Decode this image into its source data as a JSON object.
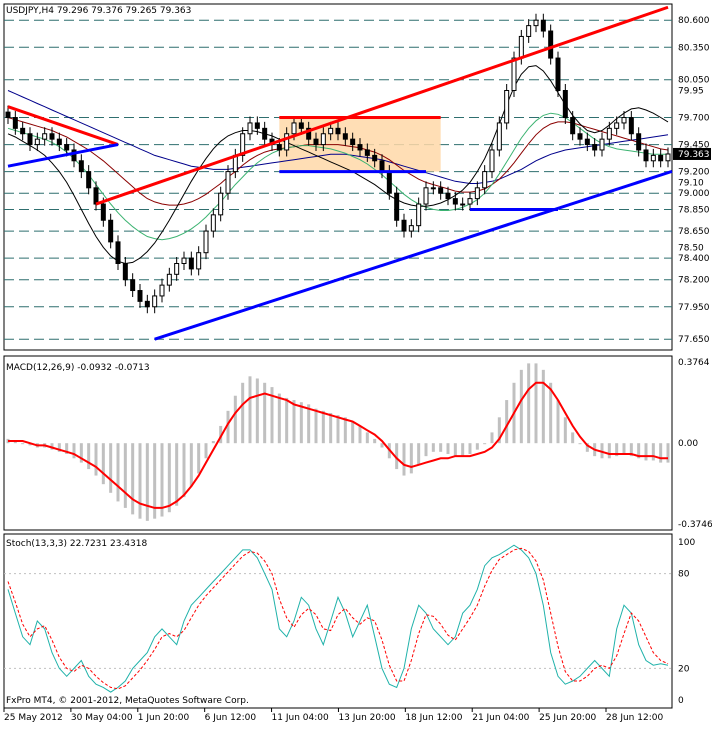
{
  "chart_data": [
    {
      "type": "candlestick",
      "header": "USDJPY,H4  79.296 79.376 79.265 79.363",
      "ylim": [
        77.55,
        80.75
      ],
      "price_levels": [
        80.6,
        80.35,
        80.05,
        79.7,
        79.45,
        79.2,
        79.0,
        78.85,
        78.65,
        78.4,
        78.2,
        77.95,
        77.65
      ],
      "price_labels": [
        "80.600",
        "80.350",
        "80.050",
        "79.700",
        "79.450",
        "79.200",
        "79.000",
        "78.850",
        "78.650",
        "78.400",
        "78.200",
        "77.950",
        "77.650"
      ],
      "extra_tick_labels": [
        {
          "value": 79.95,
          "label": "79.95"
        },
        {
          "value": 79.1,
          "label": "79.10"
        },
        {
          "value": 78.5,
          "label": "78.50"
        }
      ],
      "current_price": 79.363,
      "current_price_label": "79.363",
      "close_series": [
        79.7,
        79.6,
        79.55,
        79.45,
        79.5,
        79.55,
        79.5,
        79.45,
        79.4,
        79.3,
        79.2,
        79.05,
        78.9,
        78.75,
        78.55,
        78.35,
        78.2,
        78.1,
        78.0,
        77.95,
        78.05,
        78.15,
        78.25,
        78.35,
        78.4,
        78.3,
        78.45,
        78.65,
        78.8,
        79.0,
        79.2,
        79.35,
        79.55,
        79.65,
        79.6,
        79.5,
        79.45,
        79.4,
        79.55,
        79.65,
        79.6,
        79.5,
        79.45,
        79.55,
        79.6,
        79.55,
        79.5,
        79.45,
        79.4,
        79.35,
        79.3,
        79.2,
        79.0,
        78.75,
        78.65,
        78.7,
        78.9,
        79.05,
        79.05,
        79.0,
        78.95,
        78.9,
        78.9,
        78.95,
        79.05,
        79.2,
        79.4,
        79.65,
        79.95,
        80.25,
        80.45,
        80.55,
        80.6,
        80.5,
        80.25,
        79.95,
        79.7,
        79.55,
        79.5,
        79.45,
        79.4,
        79.5,
        79.6,
        79.65,
        79.7,
        79.55,
        79.4,
        79.3,
        79.35,
        79.3,
        79.363
      ],
      "trendlines": [
        {
          "color": "#ff0000",
          "from": [
            0,
            79.8
          ],
          "to": [
            15,
            79.45
          ]
        },
        {
          "color": "#0000ff",
          "from": [
            0,
            79.25
          ],
          "to": [
            15,
            79.45
          ]
        },
        {
          "color": "#ff0000",
          "from": [
            12,
            78.9
          ],
          "to": [
            90,
            80.72
          ]
        },
        {
          "color": "#0000ff",
          "from": [
            20,
            77.65
          ],
          "to": [
            120,
            79.85
          ]
        },
        {
          "color": "#0000ff",
          "from": [
            37,
            79.2
          ],
          "to": [
            57,
            79.2
          ]
        },
        {
          "color": "#0000ff",
          "from": [
            63,
            78.85
          ],
          "to": [
            75,
            78.85
          ]
        }
      ],
      "rectangle": {
        "from": [
          37,
          79.2
        ],
        "to": [
          59,
          79.7
        ],
        "color": "#ffd8a8"
      },
      "rectangle_top": {
        "color": "#ff0000",
        "from": [
          37,
          79.7
        ],
        "to": [
          59,
          79.7
        ]
      },
      "moving_averages": [
        {
          "color": "#00008b",
          "values": [
            79.95,
            79.92,
            79.89,
            79.86,
            79.83,
            79.8,
            79.77,
            79.74,
            79.71,
            79.68,
            79.65,
            79.62,
            79.59,
            79.56,
            79.53,
            79.5,
            79.47,
            79.44,
            79.41,
            79.38,
            79.35,
            79.33,
            79.31,
            79.29,
            79.27,
            79.25,
            79.24,
            79.23,
            79.22,
            79.22,
            79.22,
            79.23,
            79.24,
            79.25,
            79.26,
            79.27,
            79.28,
            79.29,
            79.3,
            79.31,
            79.32,
            79.33,
            79.34,
            79.35,
            79.36,
            79.36,
            79.36,
            79.35,
            79.34,
            79.33,
            79.32,
            79.31,
            79.29,
            79.27,
            79.25,
            79.23,
            79.21,
            79.19,
            79.17,
            79.15,
            79.13,
            79.11,
            79.1,
            79.09,
            79.09,
            79.1,
            79.11,
            79.13,
            79.16,
            79.19,
            79.22,
            79.26,
            79.3,
            79.33,
            79.36,
            79.38,
            79.4,
            79.41,
            79.42,
            79.43,
            79.44,
            79.45,
            79.46,
            79.47,
            79.48,
            79.49,
            79.5,
            79.51,
            79.52,
            79.53,
            79.54
          ]
        },
        {
          "color": "#8b0000",
          "values": [
            79.7,
            79.68,
            79.66,
            79.64,
            79.62,
            79.6,
            79.58,
            79.55,
            79.52,
            79.48,
            79.44,
            79.4,
            79.35,
            79.3,
            79.24,
            79.18,
            79.12,
            79.06,
            79.0,
            78.95,
            78.92,
            78.9,
            78.89,
            78.89,
            78.9,
            78.92,
            78.95,
            78.99,
            79.04,
            79.09,
            79.15,
            79.2,
            79.26,
            79.31,
            79.35,
            79.38,
            79.4,
            79.41,
            79.42,
            79.43,
            79.44,
            79.45,
            79.45,
            79.45,
            79.45,
            79.45,
            79.44,
            79.43,
            79.42,
            79.4,
            79.38,
            79.35,
            79.31,
            79.26,
            79.21,
            79.17,
            79.13,
            79.1,
            79.08,
            79.06,
            79.04,
            79.02,
            79.01,
            79.01,
            79.02,
            79.04,
            79.08,
            79.13,
            79.2,
            79.28,
            79.37,
            79.46,
            79.54,
            79.6,
            79.64,
            79.66,
            79.66,
            79.65,
            79.63,
            79.61,
            79.59,
            79.57,
            79.55,
            79.53,
            79.51,
            79.49,
            79.47,
            79.45,
            79.43,
            79.41,
            79.4
          ]
        },
        {
          "color": "#3cb371",
          "values": [
            79.6,
            79.58,
            79.56,
            79.54,
            79.52,
            79.5,
            79.47,
            79.43,
            79.38,
            79.32,
            79.25,
            79.17,
            79.08,
            78.99,
            78.9,
            78.82,
            78.75,
            78.69,
            78.64,
            78.6,
            78.58,
            78.57,
            78.58,
            78.6,
            78.63,
            78.67,
            78.72,
            78.78,
            78.85,
            78.92,
            79.0,
            79.08,
            79.15,
            79.22,
            79.28,
            79.33,
            79.37,
            79.4,
            79.42,
            79.43,
            79.44,
            79.44,
            79.43,
            79.42,
            79.41,
            79.39,
            79.37,
            79.34,
            79.31,
            79.27,
            79.22,
            79.17,
            79.11,
            79.05,
            78.99,
            78.94,
            78.9,
            78.87,
            78.85,
            78.84,
            78.84,
            78.85,
            78.87,
            78.9,
            78.94,
            79.0,
            79.08,
            79.18,
            79.29,
            79.4,
            79.51,
            79.6,
            79.67,
            79.72,
            79.74,
            79.73,
            79.7,
            79.65,
            79.6,
            79.55,
            79.5,
            79.46,
            79.43,
            79.41,
            79.4,
            79.39,
            79.38,
            79.37,
            79.36,
            79.36,
            79.36
          ]
        },
        {
          "color": "#000000",
          "values": [
            79.55,
            79.52,
            79.48,
            79.44,
            79.4,
            79.35,
            79.28,
            79.2,
            79.1,
            78.98,
            78.85,
            78.72,
            78.6,
            78.5,
            78.42,
            78.37,
            78.35,
            78.36,
            78.4,
            78.46,
            78.54,
            78.64,
            78.75,
            78.87,
            78.99,
            79.11,
            79.22,
            79.32,
            79.41,
            79.48,
            79.53,
            79.56,
            79.58,
            79.58,
            79.57,
            79.55,
            79.53,
            79.5,
            79.47,
            79.44,
            79.41,
            79.38,
            79.35,
            79.32,
            79.29,
            79.26,
            79.23,
            79.2,
            79.16,
            79.12,
            79.08,
            79.03,
            78.98,
            78.94,
            78.91,
            78.89,
            78.88,
            78.88,
            78.89,
            78.91,
            78.94,
            78.98,
            79.03,
            79.1,
            79.2,
            79.32,
            79.47,
            79.64,
            79.82,
            79.98,
            80.1,
            80.17,
            80.18,
            80.13,
            80.04,
            79.93,
            79.82,
            79.72,
            79.64,
            79.58,
            79.56,
            79.58,
            79.63,
            79.69,
            79.74,
            79.78,
            79.79,
            79.77,
            79.74,
            79.7,
            79.66
          ]
        }
      ]
    },
    {
      "type": "histogram-line",
      "header": "MACD(12,26,9) -0.0932 -0.0713",
      "ylim": [
        -0.3746,
        0.3764
      ],
      "tick_labels": [
        {
          "value": 0.3764,
          "label": "0.3764"
        },
        {
          "value": 0.0,
          "label": "0.00"
        },
        {
          "value": -0.3746,
          "label": "-0.3746"
        }
      ],
      "histogram": [
        0.02,
        0.01,
        0.0,
        -0.01,
        -0.02,
        -0.02,
        -0.03,
        -0.04,
        -0.05,
        -0.07,
        -0.09,
        -0.12,
        -0.15,
        -0.19,
        -0.23,
        -0.27,
        -0.3,
        -0.33,
        -0.35,
        -0.36,
        -0.35,
        -0.34,
        -0.32,
        -0.29,
        -0.25,
        -0.2,
        -0.14,
        -0.07,
        0.01,
        0.08,
        0.15,
        0.22,
        0.28,
        0.31,
        0.3,
        0.28,
        0.26,
        0.23,
        0.21,
        0.2,
        0.19,
        0.18,
        0.16,
        0.15,
        0.14,
        0.13,
        0.12,
        0.1,
        0.08,
        0.05,
        0.02,
        -0.02,
        -0.07,
        -0.12,
        -0.15,
        -0.14,
        -0.1,
        -0.06,
        -0.04,
        -0.04,
        -0.05,
        -0.06,
        -0.06,
        -0.05,
        -0.03,
        0.0,
        0.05,
        0.12,
        0.2,
        0.28,
        0.34,
        0.37,
        0.37,
        0.34,
        0.28,
        0.2,
        0.12,
        0.05,
        0.0,
        -0.04,
        -0.06,
        -0.07,
        -0.07,
        -0.06,
        -0.05,
        -0.06,
        -0.07,
        -0.08,
        -0.08,
        -0.09,
        -0.09
      ],
      "signal": [
        0.01,
        0.01,
        0.01,
        0.0,
        -0.01,
        -0.01,
        -0.02,
        -0.03,
        -0.04,
        -0.05,
        -0.07,
        -0.09,
        -0.11,
        -0.14,
        -0.17,
        -0.2,
        -0.23,
        -0.26,
        -0.28,
        -0.29,
        -0.3,
        -0.3,
        -0.29,
        -0.27,
        -0.24,
        -0.2,
        -0.15,
        -0.09,
        -0.03,
        0.03,
        0.09,
        0.14,
        0.18,
        0.21,
        0.22,
        0.23,
        0.22,
        0.21,
        0.2,
        0.18,
        0.17,
        0.16,
        0.15,
        0.14,
        0.13,
        0.12,
        0.11,
        0.1,
        0.08,
        0.06,
        0.04,
        0.01,
        -0.03,
        -0.07,
        -0.1,
        -0.11,
        -0.1,
        -0.09,
        -0.08,
        -0.07,
        -0.07,
        -0.06,
        -0.06,
        -0.06,
        -0.05,
        -0.04,
        -0.02,
        0.02,
        0.08,
        0.14,
        0.2,
        0.25,
        0.28,
        0.28,
        0.25,
        0.2,
        0.14,
        0.08,
        0.03,
        -0.01,
        -0.03,
        -0.04,
        -0.05,
        -0.05,
        -0.05,
        -0.05,
        -0.06,
        -0.06,
        -0.06,
        -0.07,
        -0.07
      ]
    },
    {
      "type": "line",
      "header": "Stoch(13,3,3) 22.7231 23.4318",
      "ylim": [
        0,
        100
      ],
      "tick_labels": [
        {
          "value": 100,
          "label": "100"
        },
        {
          "value": 80,
          "label": "80"
        },
        {
          "value": 20,
          "label": "20"
        },
        {
          "value": 0,
          "label": "0"
        }
      ],
      "main": [
        70,
        55,
        40,
        35,
        50,
        45,
        30,
        20,
        15,
        20,
        25,
        15,
        10,
        8,
        5,
        8,
        12,
        20,
        25,
        30,
        40,
        45,
        40,
        35,
        50,
        60,
        65,
        70,
        75,
        80,
        85,
        90,
        95,
        95,
        90,
        80,
        70,
        45,
        40,
        50,
        65,
        60,
        45,
        35,
        50,
        65,
        55,
        40,
        50,
        60,
        40,
        20,
        10,
        8,
        20,
        45,
        60,
        55,
        45,
        40,
        35,
        40,
        55,
        60,
        70,
        85,
        90,
        92,
        95,
        98,
        95,
        90,
        80,
        60,
        30,
        15,
        10,
        12,
        15,
        20,
        25,
        20,
        15,
        45,
        60,
        55,
        35,
        25,
        22,
        23,
        22
      ],
      "signal": [
        75,
        62,
        48,
        40,
        45,
        47,
        38,
        27,
        20,
        18,
        22,
        20,
        15,
        11,
        8,
        7,
        9,
        14,
        19,
        25,
        32,
        40,
        42,
        40,
        44,
        52,
        60,
        66,
        71,
        76,
        81,
        86,
        91,
        94,
        93,
        88,
        80,
        64,
        52,
        46,
        54,
        58,
        54,
        45,
        44,
        54,
        58,
        52,
        48,
        52,
        50,
        38,
        22,
        12,
        12,
        25,
        42,
        54,
        53,
        48,
        41,
        38,
        45,
        52,
        60,
        72,
        82,
        89,
        92,
        95,
        96,
        94,
        88,
        76,
        55,
        34,
        18,
        12,
        12,
        15,
        20,
        22,
        20,
        28,
        42,
        55,
        50,
        40,
        30,
        25,
        23
      ]
    }
  ],
  "x_axis": {
    "labels": [
      "25 May 2012",
      "30 May 04:00",
      "1 Jun 20:00",
      "6 Jun 12:00",
      "11 Jun 04:00",
      "13 Jun 20:00",
      "18 Jun 12:00",
      "21 Jun 04:00",
      "25 Jun 20:00",
      "28 Jun 12:00"
    ]
  },
  "footer": "FxPro MT4, © 2001-2012, MetaQuotes Software Corp.",
  "colors": {
    "bg": "#ffffff",
    "grid": "#2f6f6f",
    "candle": "#000000",
    "macd_hist": "#c0c0c0",
    "macd_signal": "#ff0000",
    "stoch_main": "#20b2aa",
    "stoch_signal": "#ff0000",
    "current_price_bg": "#000000"
  }
}
